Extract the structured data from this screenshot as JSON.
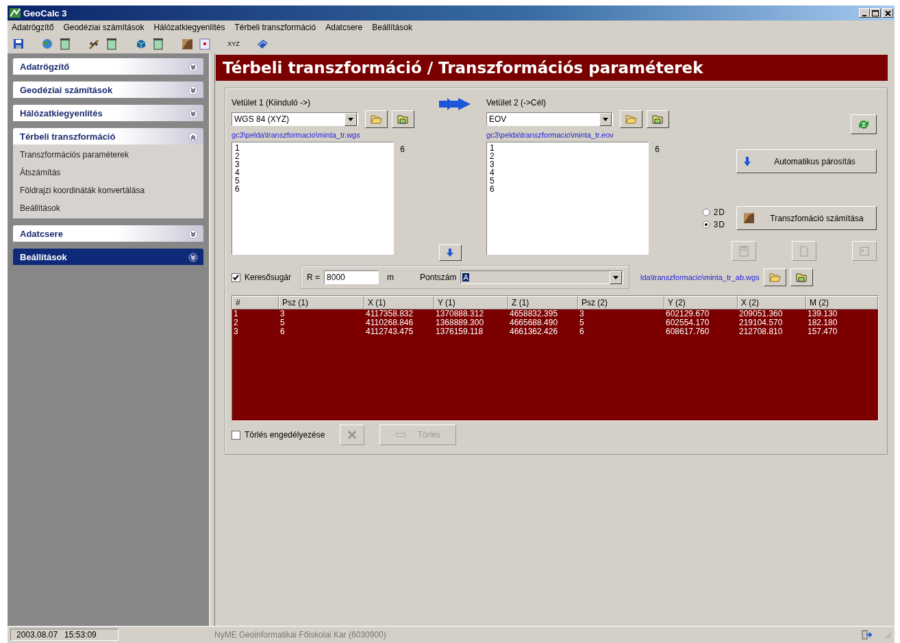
{
  "window": {
    "title": "GeoCalc 3"
  },
  "menu": [
    {
      "label": "Adatrögzítő"
    },
    {
      "label": "Geodéziai számítások"
    },
    {
      "label": "Hálózatkiegyenlítés"
    },
    {
      "label": "Térbeli transzformáció"
    },
    {
      "label": "Adatcsere"
    },
    {
      "label": "Beállítások"
    }
  ],
  "toolbar": [
    {
      "kind": "save"
    },
    {
      "kind": "gap"
    },
    {
      "kind": "globe"
    },
    {
      "kind": "window"
    },
    {
      "kind": "gap"
    },
    {
      "kind": "pen"
    },
    {
      "kind": "window"
    },
    {
      "kind": "gap"
    },
    {
      "kind": "cube"
    },
    {
      "kind": "window"
    },
    {
      "kind": "gap"
    },
    {
      "kind": "map"
    },
    {
      "kind": "frame"
    },
    {
      "kind": "gap"
    },
    {
      "kind": "text",
      "label": "XYZ"
    },
    {
      "kind": "gap"
    },
    {
      "kind": "book"
    }
  ],
  "sidebar": {
    "sections": [
      {
        "title": "Adatrögzítő",
        "expanded": false,
        "selected": false
      },
      {
        "title": "Geodéziai számítások",
        "expanded": false,
        "selected": false
      },
      {
        "title": "Hálózatkiegyenlítés",
        "expanded": false,
        "selected": false
      },
      {
        "title": "Térbeli transzformáció",
        "expanded": true,
        "selected": false,
        "items": [
          {
            "label": "Transzformációs paraméterek"
          },
          {
            "label": "Átszámítás"
          },
          {
            "label": "Földrajzi koordináták  konvertálása"
          },
          {
            "label": "Beállítások"
          }
        ]
      },
      {
        "title": "Adatcsere",
        "expanded": false,
        "selected": false
      },
      {
        "title": "Beállítások",
        "expanded": false,
        "selected": true
      }
    ]
  },
  "page_title": "Térbeli transzformáció / Transzformációs paraméterek",
  "projections": [
    {
      "label": "Vetület 1 (Kiinduló ->)",
      "value": "WGS 84 (XYZ)",
      "path": "gc3\\pelda\\transzformacio\\minta_tr.wgs",
      "count": "6",
      "points": [
        "1",
        "2",
        "3",
        "4",
        "5",
        "6"
      ]
    },
    {
      "label": "Vetület 2 (->Cél)",
      "value": "EOV",
      "path": "gc3\\pelda\\transzformacio\\minta_tr.eov",
      "count": "6",
      "points": [
        "1",
        "2",
        "3",
        "4",
        "5",
        "6"
      ]
    }
  ],
  "auto_pair_button": "Automatikus párosítás",
  "modes": [
    {
      "label": "2D",
      "selected": false
    },
    {
      "label": "3D",
      "selected": true
    }
  ],
  "compute_button": "Transzfomáció számítása",
  "search": {
    "checked": true,
    "label": "Keresősugár",
    "r_label": "R =",
    "value": "8000",
    "unit": "m"
  },
  "point": {
    "label": "Pontszám",
    "value": "A"
  },
  "result_path": "lda\\transzformacio\\minta_tr_ab.wgs",
  "table": {
    "columns": [
      "#",
      "Psz (1)",
      "X (1)",
      "Y (1)",
      "Z (1)",
      "Psz (2)",
      "Y (2)",
      "X (2)",
      "M (2)"
    ],
    "rows": [
      [
        "1",
        "3",
        "4117358.832",
        "1370888.312",
        "4658832.395",
        "3",
        "602129.670",
        "209051.360",
        "139.130"
      ],
      [
        "2",
        "5",
        "4110268.846",
        "1368889.300",
        "4665688.490",
        "5",
        "602554.170",
        "219104.570",
        "182.180"
      ],
      [
        "3",
        "6",
        "4112743.475",
        "1376159.118",
        "4661362.426",
        "6",
        "608617.760",
        "212708.810",
        "157.470"
      ]
    ]
  },
  "delete": {
    "checked": false,
    "label": "Törlés engedélyezése",
    "button": "Törlés",
    "disabled": true
  },
  "status_bar": {
    "datetime": "2003.08.07   15:53:09",
    "text": "NyME Geoinformatikai Főiskolai Kar (6030900)"
  }
}
